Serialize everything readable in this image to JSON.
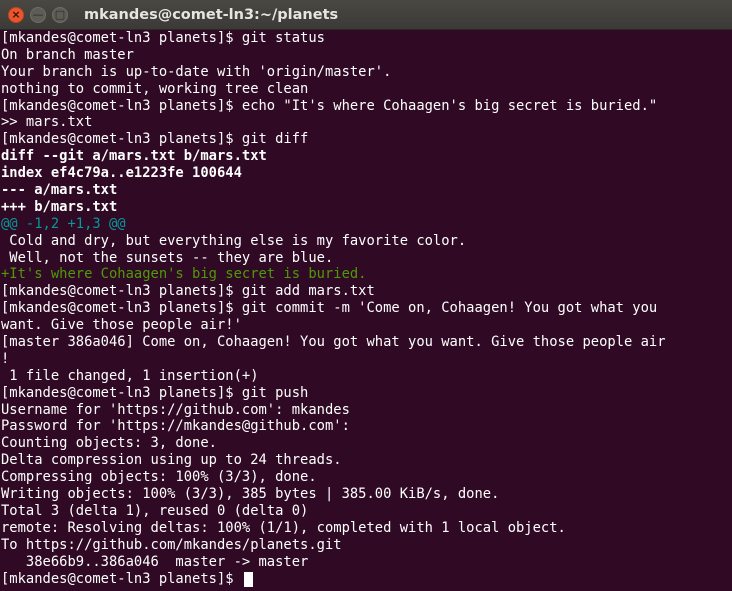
{
  "window": {
    "title": "mkandes@comet-ln3:~/planets",
    "close_glyph": "×",
    "minimize_glyph": "—",
    "maximize_glyph": "□"
  },
  "terminal": {
    "lines": [
      {
        "text": "[mkandes@comet-ln3 planets]$ git status",
        "style": "normal"
      },
      {
        "text": "On branch master",
        "style": "normal"
      },
      {
        "text": "Your branch is up-to-date with 'origin/master'.",
        "style": "normal"
      },
      {
        "text": "nothing to commit, working tree clean",
        "style": "normal"
      },
      {
        "text": "[mkandes@comet-ln3 planets]$ echo \"It's where Cohaagen's big secret is buried.\"",
        "style": "normal"
      },
      {
        "text": ">> mars.txt",
        "style": "normal"
      },
      {
        "text": "[mkandes@comet-ln3 planets]$ git diff",
        "style": "normal"
      },
      {
        "text": "diff --git a/mars.txt b/mars.txt",
        "style": "bold"
      },
      {
        "text": "index ef4c79a..e1223fe 100644",
        "style": "bold"
      },
      {
        "text": "--- a/mars.txt",
        "style": "bold"
      },
      {
        "text": "+++ b/mars.txt",
        "style": "bold"
      },
      {
        "text": "@@ -1,2 +1,3 @@",
        "style": "cyan"
      },
      {
        "text": " Cold and dry, but everything else is my favorite color.",
        "style": "normal"
      },
      {
        "text": " Well, not the sunsets -- they are blue.",
        "style": "normal"
      },
      {
        "text": "+It's where Cohaagen's big secret is buried.",
        "style": "green"
      },
      {
        "text": "[mkandes@comet-ln3 planets]$ git add mars.txt",
        "style": "normal"
      },
      {
        "text": "[mkandes@comet-ln3 planets]$ git commit -m 'Come on, Cohaagen! You got what you",
        "style": "normal"
      },
      {
        "text": "want. Give those people air!'",
        "style": "normal"
      },
      {
        "text": "[master 386a046] Come on, Cohaagen! You got what you want. Give those people air",
        "style": "normal"
      },
      {
        "text": "!",
        "style": "normal"
      },
      {
        "text": " 1 file changed, 1 insertion(+)",
        "style": "normal"
      },
      {
        "text": "[mkandes@comet-ln3 planets]$ git push",
        "style": "normal"
      },
      {
        "text": "Username for 'https://github.com': mkandes",
        "style": "normal"
      },
      {
        "text": "Password for 'https://mkandes@github.com':",
        "style": "normal"
      },
      {
        "text": "Counting objects: 3, done.",
        "style": "normal"
      },
      {
        "text": "Delta compression using up to 24 threads.",
        "style": "normal"
      },
      {
        "text": "Compressing objects: 100% (3/3), done.",
        "style": "normal"
      },
      {
        "text": "Writing objects: 100% (3/3), 385 bytes | 385.00 KiB/s, done.",
        "style": "normal"
      },
      {
        "text": "Total 3 (delta 1), reused 0 (delta 0)",
        "style": "normal"
      },
      {
        "text": "remote: Resolving deltas: 100% (1/1), completed with 1 local object.",
        "style": "normal"
      },
      {
        "text": "To https://github.com/mkandes/planets.git",
        "style": "normal"
      },
      {
        "text": "   38e66b9..386a046  master -> master",
        "style": "normal"
      }
    ],
    "prompt": "[mkandes@comet-ln3 planets]$ ",
    "colors": {
      "background": "#300a24",
      "foreground": "#ffffff",
      "diff_hunk": "#06989a",
      "diff_added": "#4e9a06"
    }
  }
}
